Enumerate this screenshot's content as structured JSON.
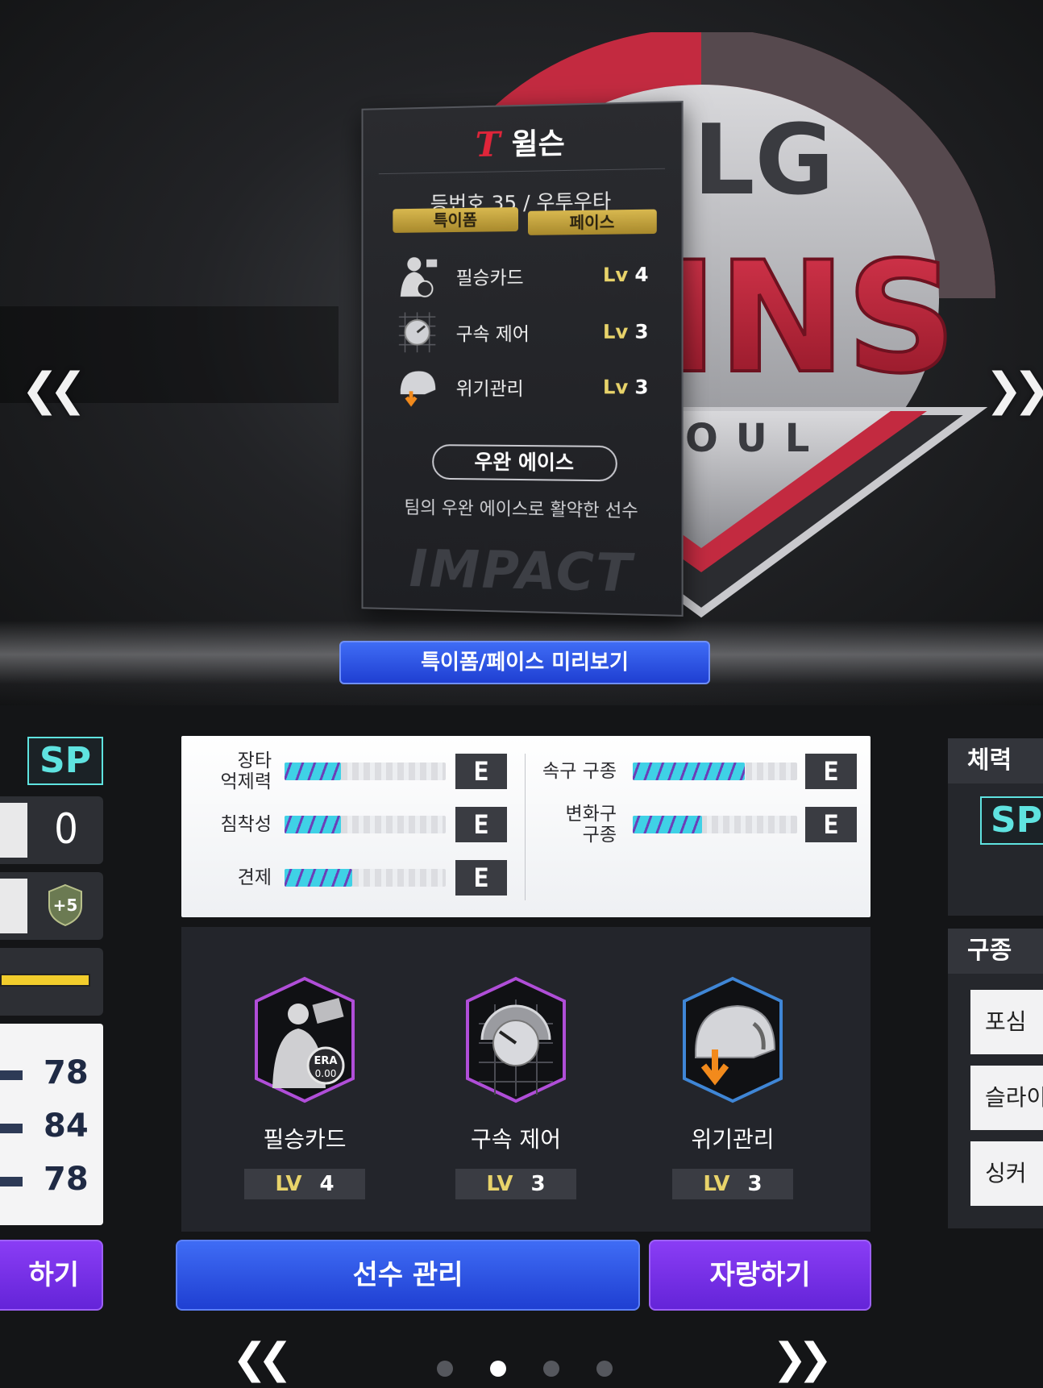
{
  "card": {
    "team_logo": "T",
    "name": "윌슨",
    "subtitle": "등번호 35 / 우투우타",
    "tags": [
      "특이폼",
      "페이스"
    ],
    "skills": [
      {
        "name": "필승카드",
        "lv_label": "Lv",
        "lv": "4",
        "icon": "ace-card-icon"
      },
      {
        "name": "구속 제어",
        "lv_label": "Lv",
        "lv": "3",
        "icon": "speed-control-icon"
      },
      {
        "name": "위기관리",
        "lv_label": "Lv",
        "lv": "3",
        "icon": "crisis-management-icon"
      }
    ],
    "role": "우완 에이스",
    "role_desc": "팀의 우완 에이스로 활약한 선수",
    "watermark": "IMPACT"
  },
  "emblem": {
    "top": "LG",
    "middle": "INS",
    "bottom": "OUL"
  },
  "preview_button": "특이폼/페이스 미리보기",
  "left_panel": {
    "badge": "SP",
    "value": "0",
    "plus_badge": "+5",
    "stats": [
      "78",
      "84",
      "78"
    ],
    "button": "하기"
  },
  "abilities": {
    "left": [
      {
        "label": "장타\n억제력",
        "fill": 0.35,
        "grade": "E"
      },
      {
        "label": "침착성",
        "fill": 0.35,
        "grade": "E"
      },
      {
        "label": "견제",
        "fill": 0.42,
        "grade": "E"
      }
    ],
    "right": [
      {
        "label": "속구 구종",
        "fill": 0.68,
        "grade": "E"
      },
      {
        "label": "변화구\n구종",
        "fill": 0.42,
        "grade": "E"
      }
    ]
  },
  "skill_panel": [
    {
      "name": "필승카드",
      "lv_label": "LV",
      "lv": "4",
      "era": "ERA",
      "era_val": "0.00",
      "border": "#b04ed8"
    },
    {
      "name": "구속 제어",
      "lv_label": "LV",
      "lv": "3",
      "border": "#b04ed8"
    },
    {
      "name": "위기관리",
      "lv_label": "LV",
      "lv": "3",
      "border": "#3f86d6"
    }
  ],
  "buttons": {
    "manage": "선수 관리",
    "show_off": "자랑하기"
  },
  "right_panel": {
    "stamina_header": "체력",
    "badge": "SP",
    "pitch_header": "구종",
    "pitches": [
      "포심",
      "슬라이",
      "싱커"
    ]
  },
  "pager": {
    "pages": 4,
    "active": 1
  },
  "colors": {
    "accent_blue": "#2a4fe0",
    "accent_purple": "#7a33ea",
    "sp_cyan": "#5fe3e0",
    "gold": "#e8d36a"
  }
}
